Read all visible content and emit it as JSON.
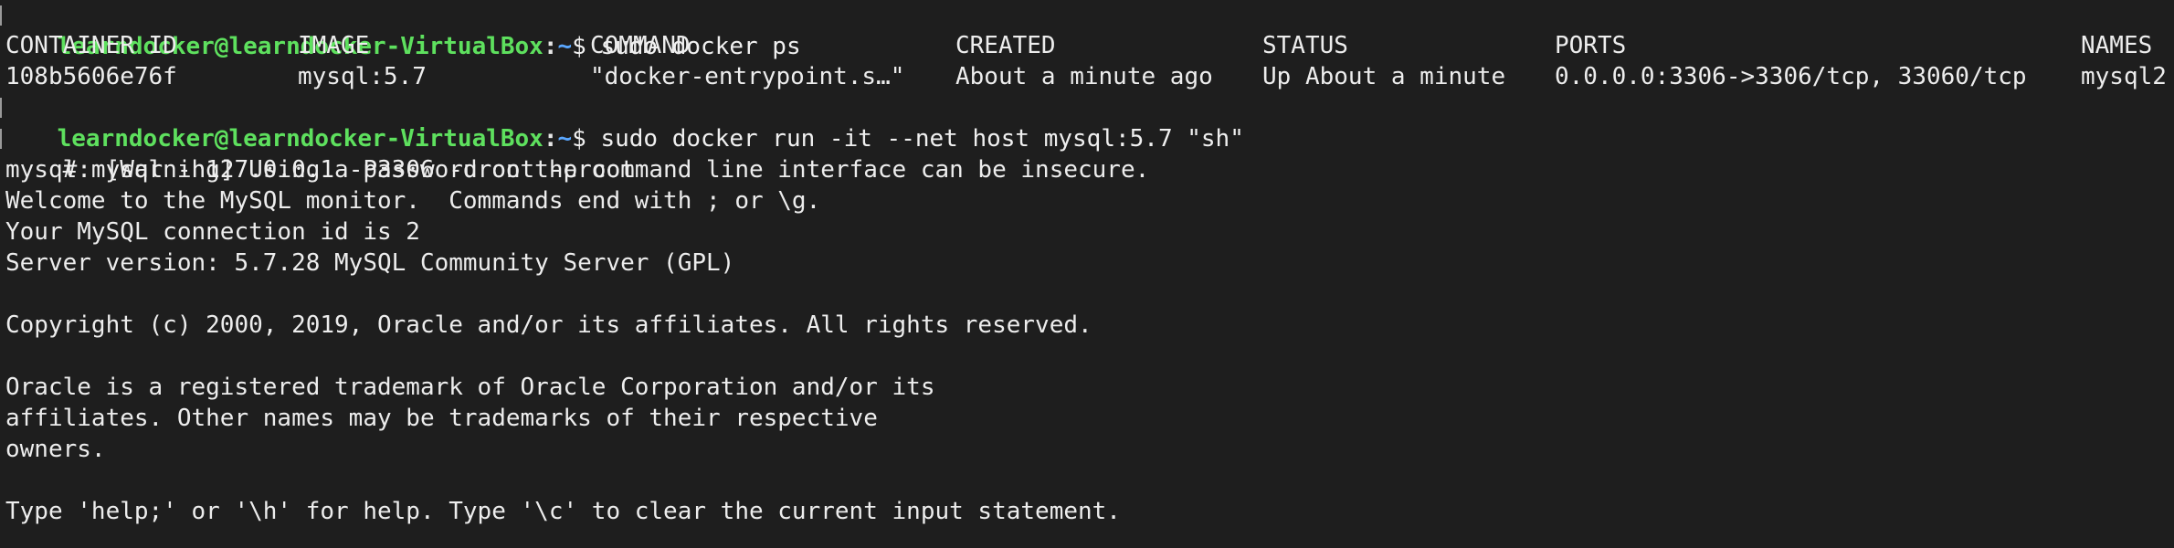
{
  "terminal": {
    "prompt": {
      "user_host": "learndocker@learndocker-VirtualBox",
      "colon": ":",
      "path": "~",
      "symbol": "$"
    },
    "commands": {
      "docker_ps": "sudo docker ps",
      "docker_run": "sudo docker run -it --net host mysql:5.7 \"sh\"",
      "mysql_login": "# mysql -h127.0.0.1 -P3306 -uroot -proot"
    },
    "ps_table": {
      "headers": {
        "container_id": "CONTAINER ID",
        "image": "IMAGE",
        "command": "COMMAND",
        "created": "CREATED",
        "status": "STATUS",
        "ports": "PORTS",
        "names": "NAMES"
      },
      "row": {
        "container_id": "108b5606e76f",
        "image": "mysql:5.7",
        "command": "\"docker-entrypoint.s…\"",
        "created": "About a minute ago",
        "status": "Up About a minute",
        "ports": "0.0.0.0:3306->3306/tcp, 33060/tcp",
        "names": "mysql2"
      }
    },
    "output": [
      "mysql: [Warning] Using a password on the command line interface can be insecure.",
      "Welcome to the MySQL monitor.  Commands end with ; or \\g.",
      "Your MySQL connection id is 2",
      "Server version: 5.7.28 MySQL Community Server (GPL)",
      "",
      "Copyright (c) 2000, 2019, Oracle and/or its affiliates. All rights reserved.",
      "",
      "Oracle is a registered trademark of Oracle Corporation and/or its",
      "affiliates. Other names may be trademarks of their respective",
      "owners.",
      "",
      "Type 'help;' or '\\h' for help. Type '\\c' to clear the current input statement."
    ]
  }
}
